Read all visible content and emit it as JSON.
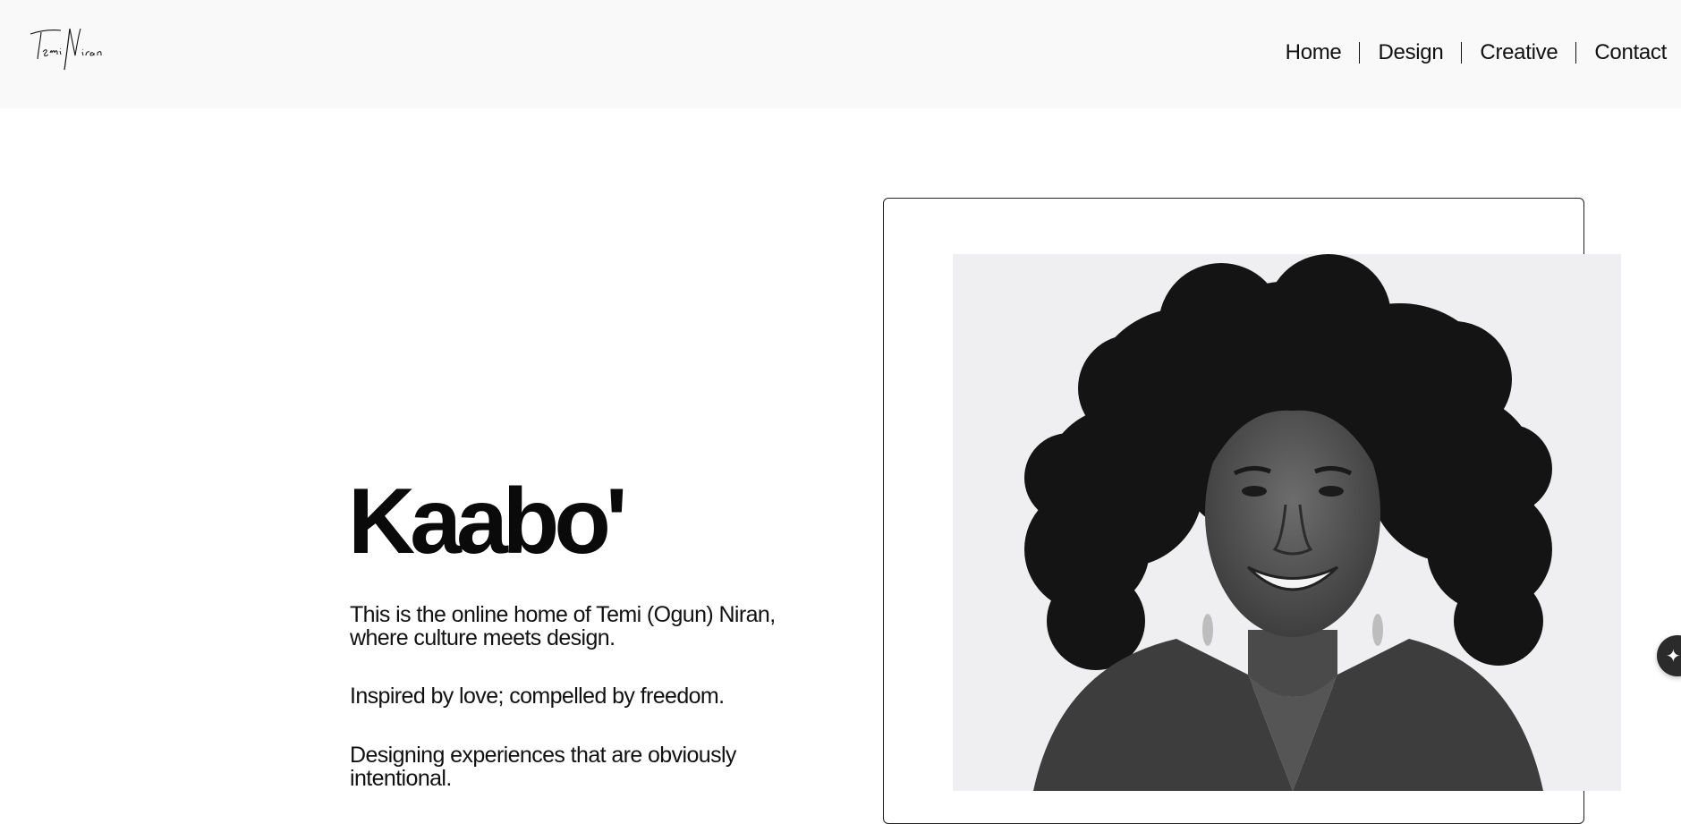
{
  "header": {
    "logo_text": "TemiNiran",
    "nav": [
      {
        "label": "Home"
      },
      {
        "label": "Design"
      },
      {
        "label": "Creative"
      },
      {
        "label": "Contact"
      }
    ]
  },
  "hero": {
    "title": "Kaabo'",
    "paragraphs": [
      "This is the online home of Temi (Ogun) Niran, where culture meets design.",
      "Inspired by love; compelled by freedom.",
      "Designing experiences that are obviously intentional."
    ]
  },
  "portrait": {
    "description": "Black and white portrait of a smiling woman with voluminous curly hair"
  },
  "floating_button": {
    "icon": "sparkle-icon"
  }
}
